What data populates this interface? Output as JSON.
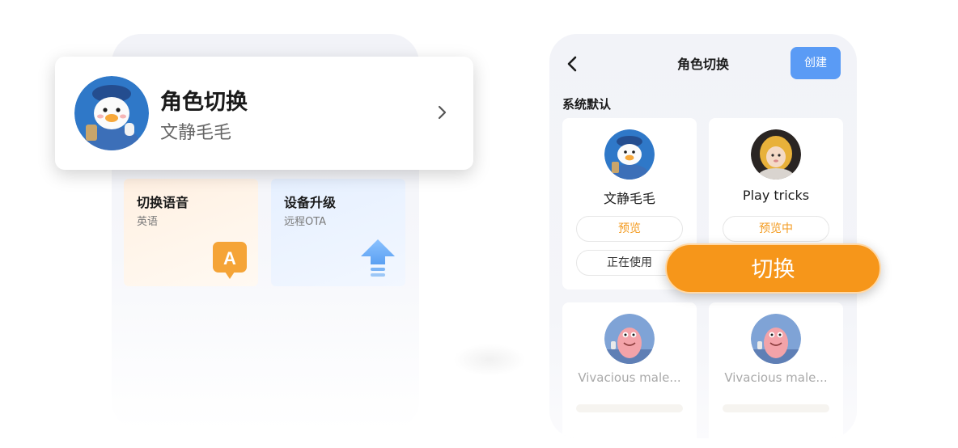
{
  "left_panel": {
    "profile": {
      "title": "角色切换",
      "name": "文静毛毛",
      "avatar_icon": "duck-avatar-icon",
      "chevron_icon": "chevron-right-icon"
    },
    "tiles": [
      {
        "title": "切换语音",
        "subtitle": "英语",
        "icon": "letter-a-badge-icon",
        "accent": "#f5a437"
      },
      {
        "title": "设备升级",
        "subtitle": "远程OTA",
        "icon": "upload-arrow-icon",
        "accent": "#6aa9f5"
      }
    ]
  },
  "right_panel": {
    "header": {
      "back_icon": "chevron-left-icon",
      "title": "角色切换",
      "create_label": "创建"
    },
    "section_label": "系统默认",
    "cards": [
      {
        "name": "文静毛毛",
        "avatar_icon": "duck-avatar-icon",
        "preview_label": "预览",
        "status_label": "正在使用"
      },
      {
        "name": "Play tricks",
        "avatar_icon": "child-photo-avatar-icon",
        "preview_label": "预览中"
      },
      {
        "name": "Vivacious male...",
        "avatar_icon": "starfish-avatar-icon"
      },
      {
        "name": "Vivacious male...",
        "avatar_icon": "starfish-avatar-icon"
      }
    ]
  },
  "switch_button": {
    "label": "切换",
    "color": "#f6961a"
  },
  "colors": {
    "primary_blue": "#5a9bf5",
    "orange": "#f39a1e"
  }
}
